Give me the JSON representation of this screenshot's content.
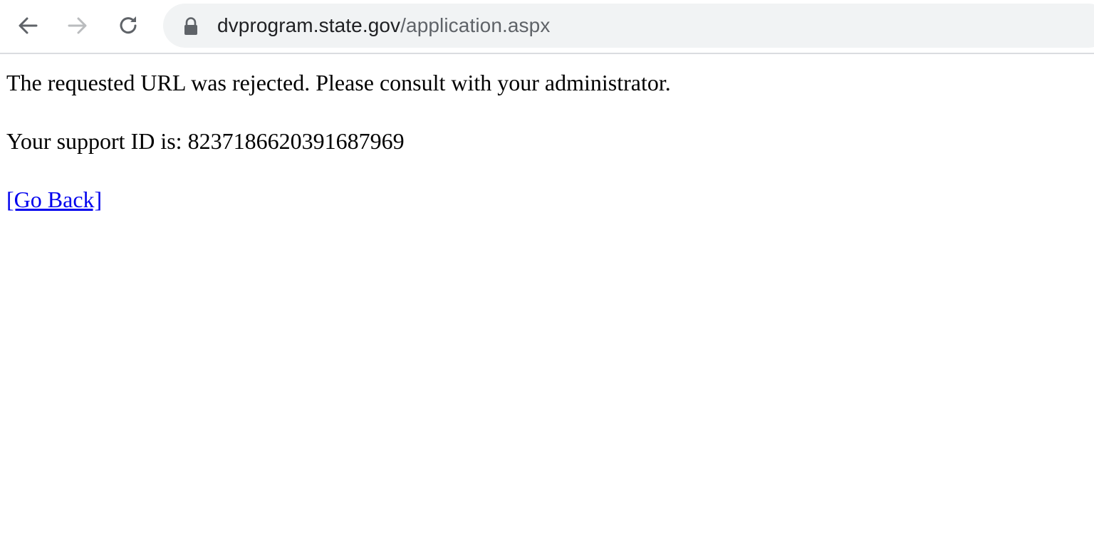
{
  "browser": {
    "url": {
      "host": "dvprogram.state.gov",
      "path": "/application.aspx"
    },
    "icons": {
      "back": "arrow-left-icon",
      "forward": "arrow-right-icon",
      "reload": "reload-icon",
      "lock": "lock-icon"
    },
    "colors": {
      "omnibox_bg": "#f1f3f4",
      "icon_active": "#5f6368",
      "icon_disabled": "#babcbe"
    }
  },
  "page": {
    "message": "The requested URL was rejected. Please consult with your administrator.",
    "support_id_line": "Your support ID is: 8237186620391687969",
    "go_back_link": "[Go Back]",
    "link_color": "#0000ee"
  }
}
